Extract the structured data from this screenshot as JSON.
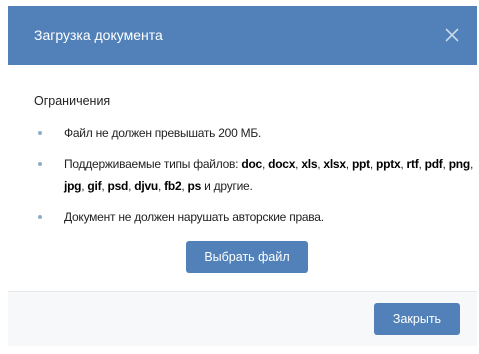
{
  "dialog": {
    "title": "Загрузка документа",
    "close_icon": "close-icon"
  },
  "restrictions": {
    "heading": "Ограничения",
    "items": [
      {
        "text": "Файл не должен превышать 200 МБ."
      },
      {
        "prefix": "Поддерживаемые типы файлов: ",
        "file_types": [
          "doc",
          "docx",
          "xls",
          "xlsx",
          "ppt",
          "pptx",
          "rtf",
          "pdf",
          "png",
          "jpg",
          "gif",
          "psd",
          "djvu",
          "fb2",
          "ps"
        ],
        "suffix": " и другие."
      },
      {
        "text": "Документ не должен нарушать авторские права."
      }
    ]
  },
  "actions": {
    "choose_file_label": "Выбрать файл",
    "close_label": "Закрыть"
  },
  "colors": {
    "header_bg": "#5181b8",
    "button_bg": "#5181b8",
    "bullet": "#8fadc8",
    "footer_bg": "#f7f8fa"
  }
}
